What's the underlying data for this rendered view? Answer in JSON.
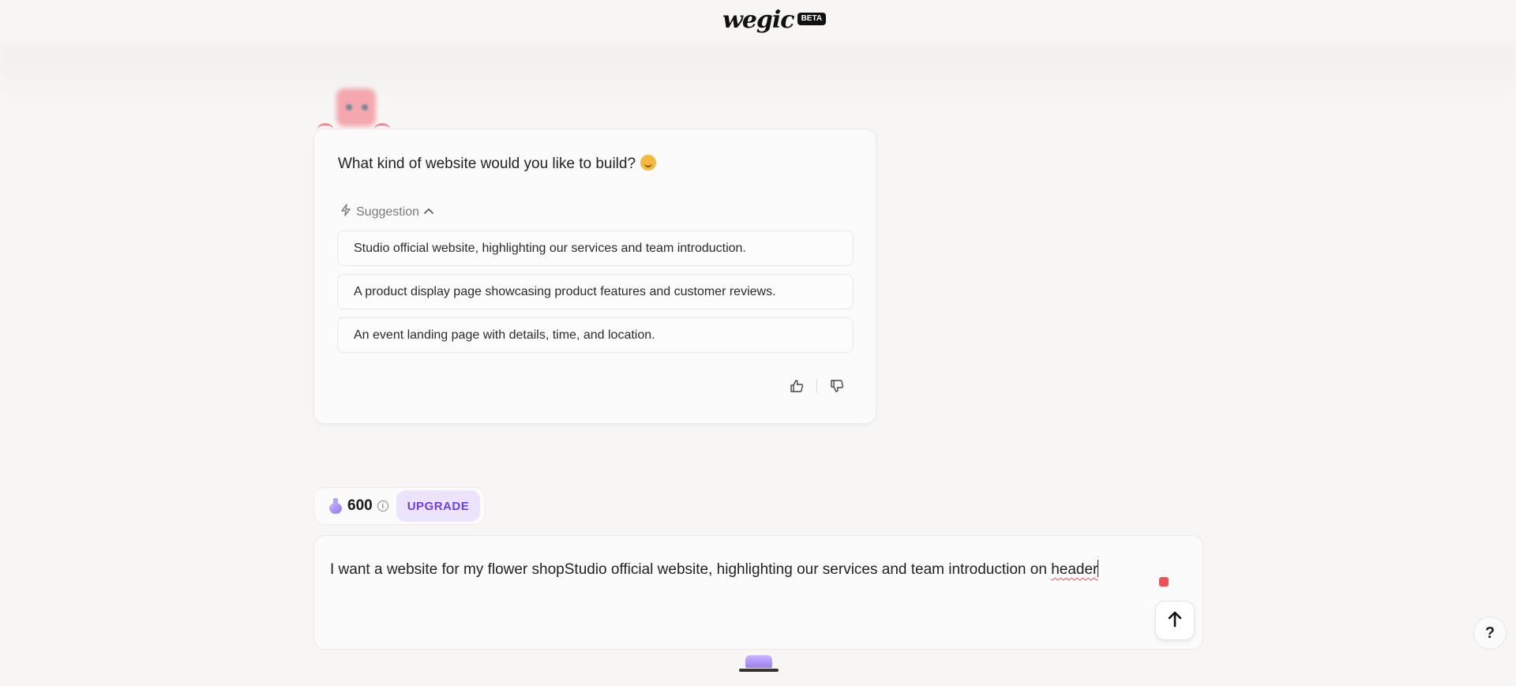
{
  "header": {
    "logo_text": "wegic",
    "badge": "BETA"
  },
  "chat": {
    "question": "What kind of website would you like to build?",
    "suggestion_toggle_label": "Suggestion",
    "suggestions": [
      "Studio official website, highlighting our services and team introduction.",
      "A product display page showcasing product features and customer reviews.",
      "An event landing page with details, time, and location."
    ],
    "icons": {
      "suggestion": "lightning-icon",
      "collapse": "chevron-up-icon",
      "like": "thumbs-up-icon",
      "dislike": "thumbs-down-icon"
    }
  },
  "credits": {
    "count": "600",
    "info_glyph": "i",
    "upgrade_label": "UPGRADE"
  },
  "composer": {
    "text_main": "I want a website for my flower shopStudio official website, highlighting our services and team introduction on ",
    "text_misspelled": "header",
    "send_icon": "arrow-up-icon"
  },
  "help": {
    "label": "?"
  },
  "colors": {
    "background": "#f7f6f5",
    "accent_purple": "#6d3fdc",
    "upgrade_bg": "#ece4ff",
    "recording_dot": "#ef4f56"
  }
}
